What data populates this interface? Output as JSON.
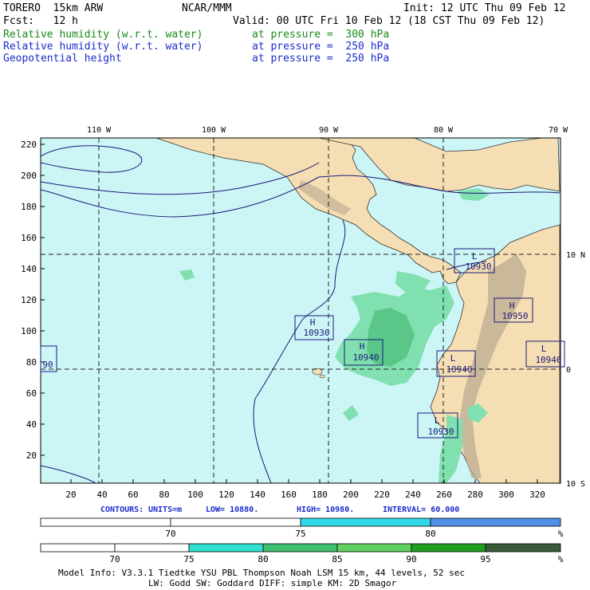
{
  "header": {
    "model": "TORERO  15km ARW",
    "org": "NCAR/MMM",
    "init": "Init: 12 UTC Thu 09 Feb 12",
    "fcst": "Fcst:   12 h",
    "valid": "Valid: 00 UTC Fri 10 Feb 12 (18 CST Thu 09 Feb 12)",
    "fields": [
      {
        "name": "Relative humidity (w.r.t. water)",
        "level": "at pressure =  300 hPa",
        "color": "#1a8a1a"
      },
      {
        "name": "Relative humidity (w.r.t. water)",
        "level": "at pressure =  250 hPa",
        "color": "#1c2ccc"
      },
      {
        "name": "Geopotential height",
        "level": "at pressure =  250 hPa",
        "color": "#1c2ccc"
      }
    ]
  },
  "map": {
    "lon_labels": [
      "110 W",
      "100 W",
      "90 W",
      "80 W",
      "70 W"
    ],
    "lat_labels": [
      "10 N",
      "0",
      "10 S"
    ],
    "y_ticks": [
      "220",
      "200",
      "180",
      "160",
      "140",
      "120",
      "100",
      "80",
      "60",
      "40",
      "20"
    ],
    "x_ticks": [
      "20",
      "40",
      "60",
      "80",
      "100",
      "120",
      "140",
      "160",
      "180",
      "200",
      "220",
      "240",
      "260",
      "280",
      "300",
      "320"
    ],
    "ocean_color": "#ccf5f5",
    "land_color": "#f5deb3",
    "contour_color": "#1a1a7a",
    "highs_lows": [
      {
        "type": "L",
        "value": "10930"
      },
      {
        "type": "H",
        "value": "10950"
      },
      {
        "type": "H",
        "value": "10930"
      },
      {
        "type": "H",
        "value": "10940"
      },
      {
        "type": "L",
        "value": "10940"
      },
      {
        "type": "L",
        "value": "10940"
      },
      {
        "type": "L",
        "value": "10930"
      },
      {
        "type": "",
        "value": "90"
      }
    ]
  },
  "contour_info": {
    "label": "CONTOURS:",
    "units": "UNITS=m",
    "low": "LOW=  10880.",
    "high": "HIGH=  10980.",
    "interval": "INTERVAL=  60.000"
  },
  "colorbar1": {
    "labels": [
      "70",
      "75",
      "80"
    ],
    "unit": "%",
    "colors": [
      "#ffffff",
      "#ffffff",
      "#30d8e8",
      "#5090e8"
    ]
  },
  "colorbar2": {
    "labels": [
      "70",
      "75",
      "80",
      "85",
      "90",
      "95"
    ],
    "unit": "%",
    "colors": [
      "#ffffff",
      "#ffffff",
      "#30e0d0",
      "#40c070",
      "#60d060",
      "#20a020",
      "#3a5a3a"
    ]
  },
  "footer": {
    "line1": "Model Info: V3.3.1   Tiedtke YSU PBL  Thompson    Noah LSM  15 km,   44 levels,   52 sec",
    "line2": "LW: Godd SW: Goddard DIFF: simple KM: 2D Smagor"
  }
}
